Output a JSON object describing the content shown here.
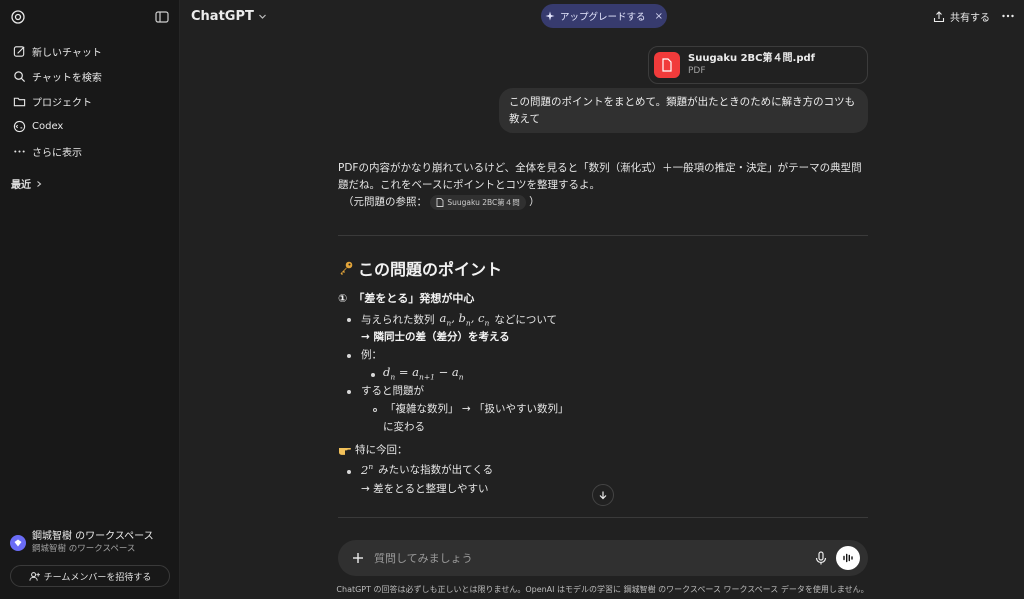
{
  "sidebar": {
    "items": [
      {
        "label": "新しいチャット",
        "icon": "new-chat-icon"
      },
      {
        "label": "チャットを検索",
        "icon": "search-icon"
      },
      {
        "label": "プロジェクト",
        "icon": "folder-icon"
      },
      {
        "label": "Codex",
        "icon": "codex-icon"
      },
      {
        "label": "さらに表示",
        "icon": "more-dots-icon"
      }
    ],
    "recent_label": "最近",
    "workspace": {
      "name": "鋼城智樹 のワークスペース",
      "sub": "鋼城智樹 のワークスペース"
    },
    "invite_label": "チームメンバーを招待する"
  },
  "header": {
    "model": "ChatGPT",
    "upgrade_label": "アップグレードする",
    "share_label": "共有する"
  },
  "chat": {
    "file": {
      "name": "Suugaku 2BC第４問.pdf",
      "type": "PDF"
    },
    "user_message": "この問題のポイントをまとめて。類題が出たときのために解き方のコツも教えて",
    "answer": {
      "intro": "PDFの内容がかなり崩れているけど、全体を見ると「数列（漸化式）＋一般項の推定・決定」がテーマの典型問題だね。これをベースにポイントとコツを整理するよ。",
      "ref_prefix": "（元問題の参照：",
      "ref_file": "Suugaku 2BC第４問",
      "ref_suffix": "）",
      "heading": "この問題のポイント",
      "section_num": "①",
      "section_title": "「差をとる」発想が中心",
      "b1_pre": "与えられた数列",
      "b1_post": "などについて",
      "b1_arrow": "→ 隣同士の差（差分）を考える",
      "b2": "例：",
      "b3": "すると問題が",
      "b3_sub": "「複雑な数列」 → 「扱いやすい数列」",
      "b3_sub2": "に変わる",
      "note": "特に今回：",
      "b4_post": "みたいな指数が出てくる",
      "b4_arrow": "→ 差をとると整理しやすい"
    }
  },
  "composer": {
    "placeholder": "質問してみましょう"
  },
  "disclaimer": "ChatGPT の回答は必ずしも正しいとは限りません。OpenAI はモデルの学習に 鋼城智樹 のワークスペース ワークスペース データを使用しません。",
  "colors": {
    "accent_upgrade": "#373b6e",
    "pdf_icon": "#f13b3b",
    "workspace_avatar": "#6a6cf6"
  }
}
